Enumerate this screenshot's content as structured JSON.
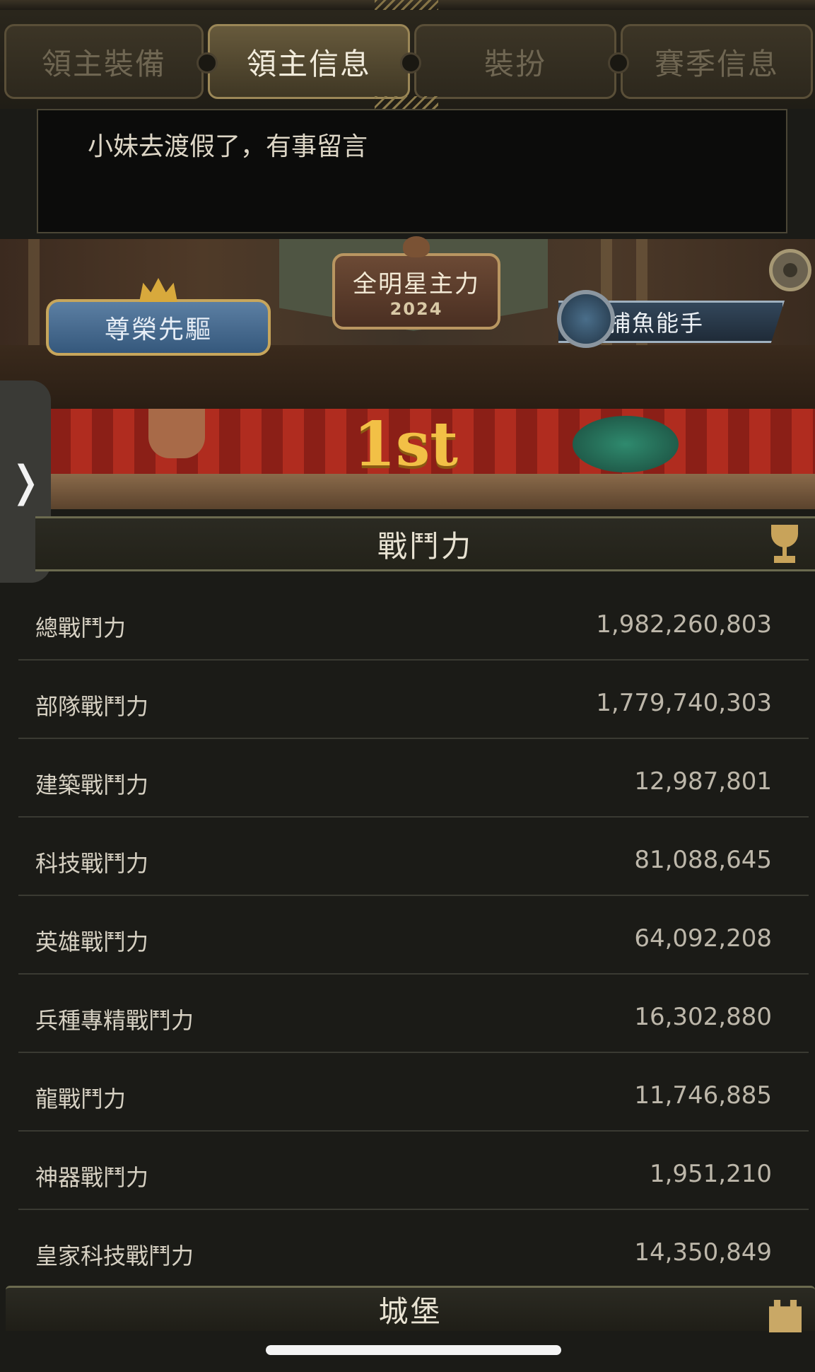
{
  "tabs": [
    {
      "label": "領主裝備",
      "active": false
    },
    {
      "label": "領主信息",
      "active": true
    },
    {
      "label": "裝扮",
      "active": false
    },
    {
      "label": "賽季信息",
      "active": false
    }
  ],
  "profile": {
    "message": "小妹去渡假了，有事留言"
  },
  "badges": {
    "left": "尊榮先驅",
    "center_title": "全明星主力",
    "center_year": "2024",
    "right": "捕魚能手"
  },
  "banner": {
    "text": "1st"
  },
  "drawer": {
    "arrow": "❭"
  },
  "power": {
    "title": "戰鬥力",
    "rows": [
      {
        "label": "總戰鬥力",
        "value": "1,982,260,803"
      },
      {
        "label": "部隊戰鬥力",
        "value": "1,779,740,303"
      },
      {
        "label": "建築戰鬥力",
        "value": "12,987,801"
      },
      {
        "label": "科技戰鬥力",
        "value": "81,088,645"
      },
      {
        "label": "英雄戰鬥力",
        "value": "64,092,208"
      },
      {
        "label": "兵種專精戰鬥力",
        "value": "16,302,880"
      },
      {
        "label": "龍戰鬥力",
        "value": "11,746,885"
      },
      {
        "label": "神器戰鬥力",
        "value": "1,951,210"
      },
      {
        "label": "皇家科技戰鬥力",
        "value": "14,350,849"
      }
    ]
  },
  "castle": {
    "title": "城堡"
  },
  "colors": {
    "accent_gold": "#c8a35a",
    "background": "#1b1b17"
  }
}
